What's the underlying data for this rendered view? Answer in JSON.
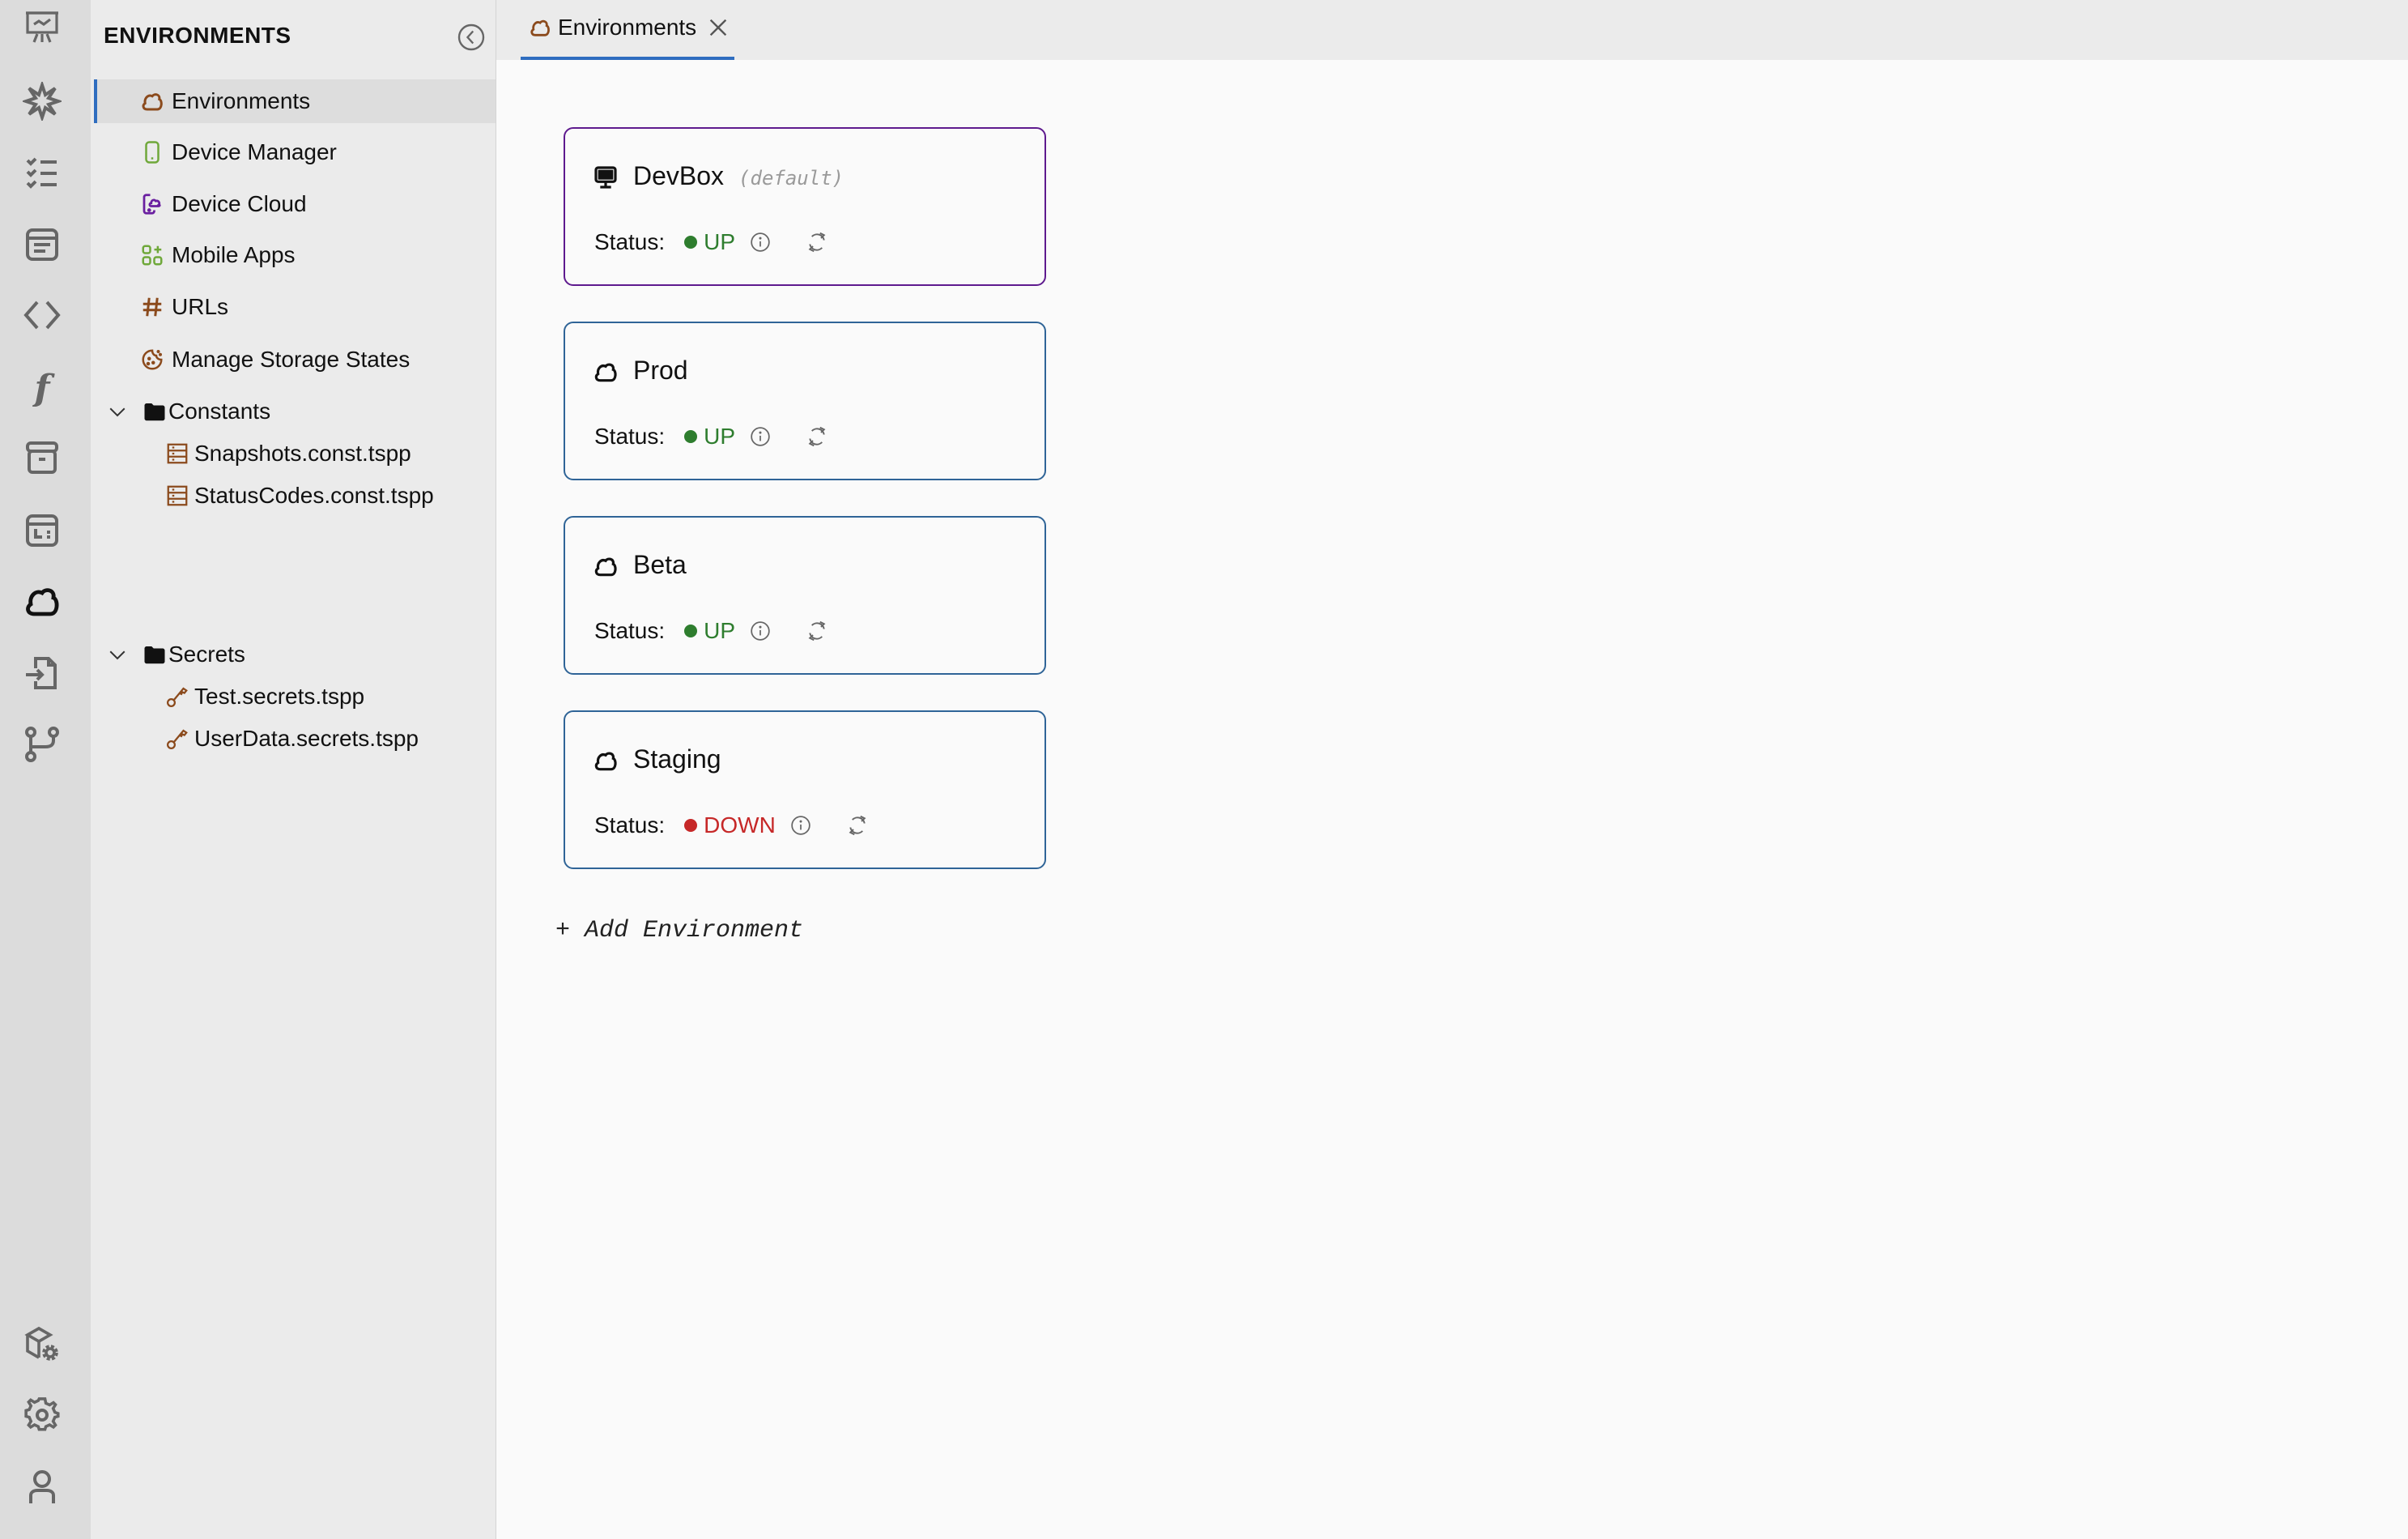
{
  "activity_bar": {
    "top_icons": [
      "presentation-chart-icon",
      "sparkle-icon",
      "checklist-icon",
      "browser-window-icon",
      "code-brackets-icon",
      "function-icon",
      "archive-box-icon",
      "calendar-card-icon",
      "cloud-icon",
      "file-import-icon",
      "git-branch-icon"
    ],
    "bottom_icons": [
      "package-settings-icon",
      "gear-icon",
      "user-icon"
    ],
    "active": "cloud-icon"
  },
  "sidebar": {
    "title": "ENVIRONMENTS",
    "items": [
      {
        "label": "Environments",
        "icon": "cloud-icon",
        "color": "#8b4a1c",
        "active": true
      },
      {
        "label": "Device Manager",
        "icon": "mobile-phone-icon",
        "color": "#6fa83a"
      },
      {
        "label": "Device Cloud",
        "icon": "device-cloud-icon",
        "color": "#6a1fa0"
      },
      {
        "label": "Mobile Apps",
        "icon": "apps-grid-icon",
        "color": "#6fa83a"
      },
      {
        "label": "URLs",
        "icon": "hash-icon",
        "color": "#8b4a1c"
      },
      {
        "label": "Manage Storage States",
        "icon": "cookie-icon",
        "color": "#8b4a1c"
      }
    ],
    "folders": [
      {
        "label": "Constants",
        "expanded": true,
        "files": [
          {
            "label": "Snapshots.const.tspp",
            "icon": "table-icon"
          },
          {
            "label": "StatusCodes.const.tspp",
            "icon": "table-icon"
          }
        ]
      },
      {
        "label": "Secrets",
        "expanded": true,
        "files": [
          {
            "label": "Test.secrets.tspp",
            "icon": "key-icon"
          },
          {
            "label": "UserData.secrets.tspp",
            "icon": "key-icon"
          }
        ]
      }
    ]
  },
  "tabs": [
    {
      "label": "Environments",
      "icon": "cloud-icon",
      "active": true
    }
  ],
  "main": {
    "status_label": "Status:",
    "default_tag": "(default)",
    "environments": [
      {
        "name": "DevBox",
        "icon": "monitor-icon",
        "is_default": true,
        "status": "UP",
        "status_color": "#2e7d2e"
      },
      {
        "name": "Prod",
        "icon": "cloud-icon",
        "is_default": false,
        "status": "UP",
        "status_color": "#2e7d2e"
      },
      {
        "name": "Beta",
        "icon": "cloud-icon",
        "is_default": false,
        "status": "UP",
        "status_color": "#2e7d2e"
      },
      {
        "name": "Staging",
        "icon": "cloud-icon",
        "is_default": false,
        "status": "DOWN",
        "status_color": "#c62828"
      }
    ],
    "add_label": "+ Add Environment"
  },
  "colors": {
    "accent": "#2f6dbf",
    "default_card_border": "#5e1a8e",
    "card_border": "#2f6497",
    "brown_icon": "#8b4a1c"
  }
}
